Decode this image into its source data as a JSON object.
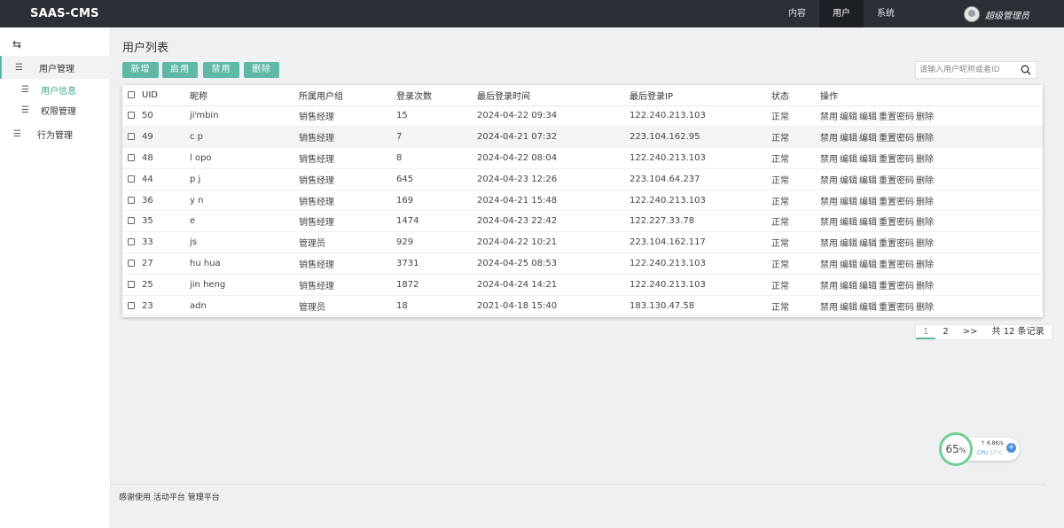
{
  "app": {
    "logo": "SAAS-CMS"
  },
  "topnav": [
    {
      "label": "内容",
      "active": false
    },
    {
      "label": "用户",
      "active": true
    },
    {
      "label": "系统",
      "active": false
    }
  ],
  "user": {
    "name": "超级管理员"
  },
  "sidebar": {
    "collapse_icon": "⇆",
    "items": [
      {
        "label": "用户管理",
        "type": "group"
      },
      {
        "label": "用户信息",
        "type": "sub",
        "active": true
      },
      {
        "label": "权限管理",
        "type": "sub"
      },
      {
        "label": "行为管理",
        "type": "group"
      }
    ]
  },
  "page": {
    "title": "用户列表"
  },
  "toolbar": {
    "buttons": [
      "新增",
      "启用",
      "禁用",
      "删除"
    ],
    "search_placeholder": "请输入用户昵称或者ID"
  },
  "table": {
    "headers": [
      "UID",
      "昵称",
      "所属用户组",
      "登录次数",
      "最后登录时间",
      "最后登录IP",
      "状态",
      "操作"
    ],
    "ops": [
      "禁用",
      "编辑",
      "编辑",
      "重置密码",
      "删除"
    ],
    "rows": [
      [
        "50",
        "jiⁱmbin",
        "销售经理",
        "15",
        "2024-04-22 09:34",
        "122.240.213.103",
        "正常"
      ],
      [
        "49",
        "c  p",
        "销售经理",
        "7",
        "2024-04-21 07:32",
        "223.104.162.95",
        "正常"
      ],
      [
        "48",
        "l  opo",
        "销售经理",
        "8",
        "2024-04-22 08:04",
        "122.240.213.103",
        "正常"
      ],
      [
        "44",
        "p  j",
        "销售经理",
        "645",
        "2024-04-23 12:26",
        "223.104.64.237",
        "正常"
      ],
      [
        "36",
        "y  n",
        "销售经理",
        "169",
        "2024-04-21 15:48",
        "122.240.213.103",
        "正常"
      ],
      [
        "35",
        "e",
        "销售经理",
        "1474",
        "2024-04-23 22:42",
        "122.227.33.78",
        "正常"
      ],
      [
        "33",
        "js",
        "管理员",
        "929",
        "2024-04-22 10:21",
        "223.104.162.117",
        "正常"
      ],
      [
        "27",
        "hu  hua",
        "销售经理",
        "3731",
        "2024-04-25 08:53",
        "122.240.213.103",
        "正常"
      ],
      [
        "25",
        "jin    heng",
        "销售经理",
        "1872",
        "2024-04-24 14:21",
        "122.240.213.103",
        "正常"
      ],
      [
        "23",
        "adn",
        "管理员",
        "18",
        "2021-04-18 15:40",
        "183.130.47.58",
        "正常"
      ]
    ]
  },
  "pager": {
    "pages": [
      "1",
      "2"
    ],
    "next": ">>",
    "total": "共 12 条记录"
  },
  "widget": {
    "percent": "65",
    "percent_unit": "%",
    "net": "6.8K/s",
    "cpu_label": "CPU",
    "cpu_temp": "37°C",
    "plus": "+"
  },
  "footer": {
    "text": "感谢使用 活动平台 管理平台"
  },
  "colors": {
    "accent": "#5fb8a5",
    "topbar": "#2b2f36"
  }
}
